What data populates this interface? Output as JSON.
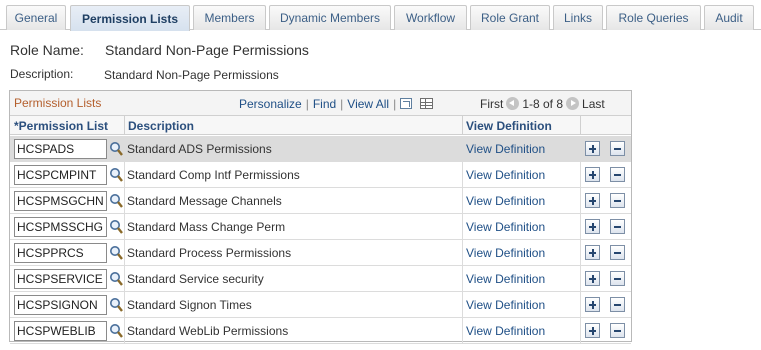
{
  "tabs": [
    {
      "label": "General"
    },
    {
      "label": "Permission Lists"
    },
    {
      "label": "Members"
    },
    {
      "label": "Dynamic Members"
    },
    {
      "label": "Workflow"
    },
    {
      "label": "Role Grant"
    },
    {
      "label": "Links"
    },
    {
      "label": "Role Queries"
    },
    {
      "label": "Audit"
    }
  ],
  "role_name_label": "Role Name:",
  "role_name_value": "Standard Non-Page Permissions",
  "description_label": "Description:",
  "description_value": "Standard Non-Page Permissions",
  "grid": {
    "title": "Permission Lists",
    "personalize": "Personalize",
    "find": "Find",
    "view_all": "View All",
    "first": "First",
    "range": "1-8 of 8",
    "last": "Last",
    "columns": {
      "permission_list": "*Permission List",
      "description": "Description",
      "view_definition": "View Definition"
    },
    "rows": [
      {
        "code": "HCSPADS",
        "description": "Standard ADS Permissions",
        "link": "View Definition"
      },
      {
        "code": "HCSPCMPINT",
        "description": "Standard Comp Intf Permissions",
        "link": "View Definition"
      },
      {
        "code": "HCSPMSGCHN",
        "description": "Standard Message Channels",
        "link": "View Definition"
      },
      {
        "code": "HCSPMSSCHG",
        "description": "Standard Mass Change Perm",
        "link": "View Definition"
      },
      {
        "code": "HCSPPRCS",
        "description": "Standard Process Permissions",
        "link": "View Definition"
      },
      {
        "code": "HCSPSERVICE",
        "description": "Standard Service security",
        "link": "View Definition"
      },
      {
        "code": "HCSPSIGNON",
        "description": "Standard Signon Times",
        "link": "View Definition"
      },
      {
        "code": "HCSPWEBLIB",
        "description": "Standard WebLib Permissions",
        "link": "View Definition"
      }
    ]
  },
  "colors": {
    "grid_title": "#b45f2d",
    "link": "#1f4f86",
    "selected_row": "#dcdcdc"
  },
  "icons": {
    "lookup": "magnifier-icon",
    "zoom": "new-window-icon",
    "download": "grid-download-icon",
    "prev": "previous-icon",
    "next": "next-icon",
    "add_row": "plus-icon",
    "delete_row": "minus-icon"
  }
}
